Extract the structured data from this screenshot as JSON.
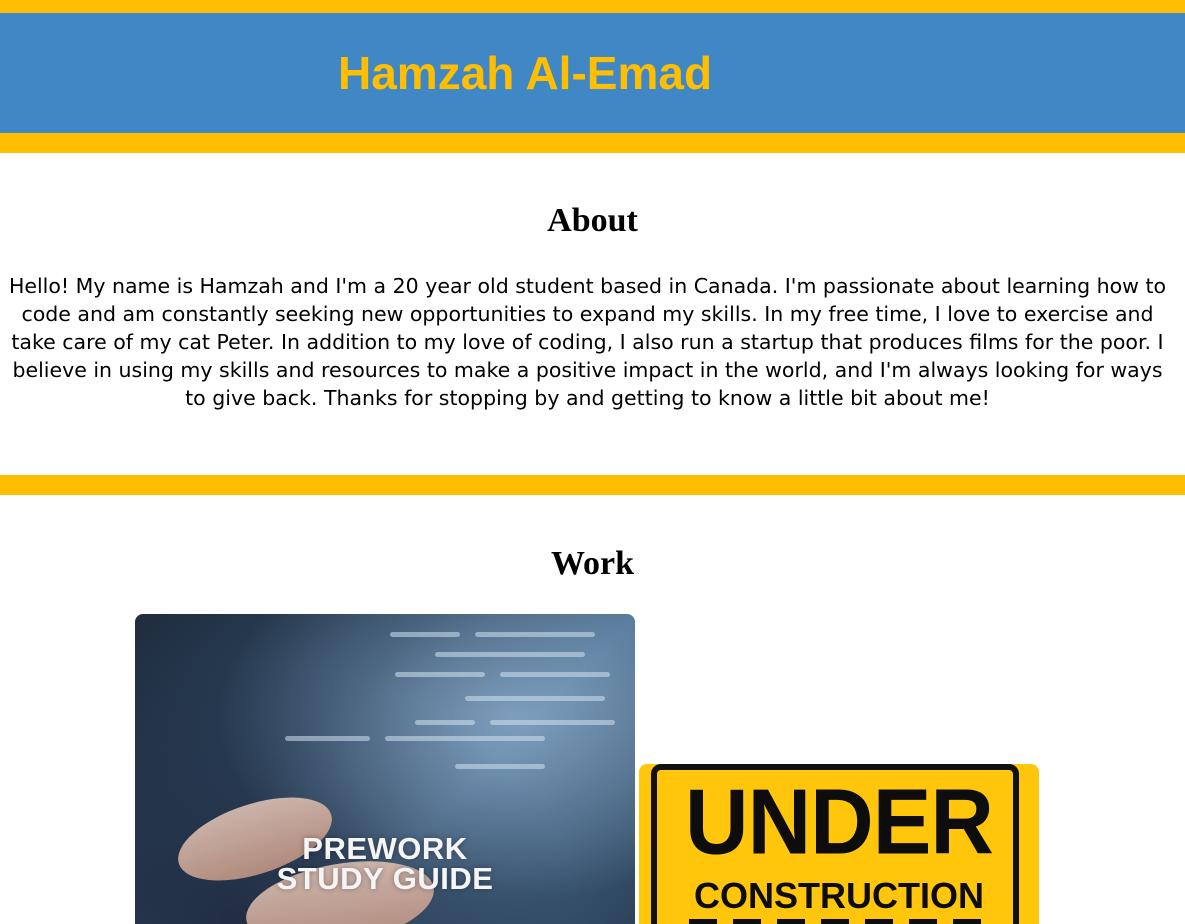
{
  "header": {
    "title": "Hamzah Al-Emad"
  },
  "about": {
    "heading": "About",
    "text": "Hello! My name is Hamzah and I'm a 20 year old student based in Canada. I'm passionate about learning how to code and am constantly seeking new opportunities to expand my skills. In my free time, I love to exercise and take care of my cat Peter. In addition to my love of coding, I also run a startup that produces films for the poor. I believe in using my skills and resources to make a positive impact in the world, and I'm always looking for ways to give back. Thanks for stopping by and getting to know a little bit about me!"
  },
  "work": {
    "heading": "Work",
    "projects": [
      {
        "label_line1": "PREWORK",
        "label_line2": "STUDY GUIDE",
        "icon": "prework-study-guide-image"
      },
      {
        "label_line1": "UNDER",
        "label_line2": "CONSTRUCTION",
        "icon": "under-construction-sign-image"
      }
    ]
  },
  "colors": {
    "accent_yellow": "#ffbf00",
    "header_blue": "#4087c6",
    "construction_yellow": "#ffc60b"
  }
}
